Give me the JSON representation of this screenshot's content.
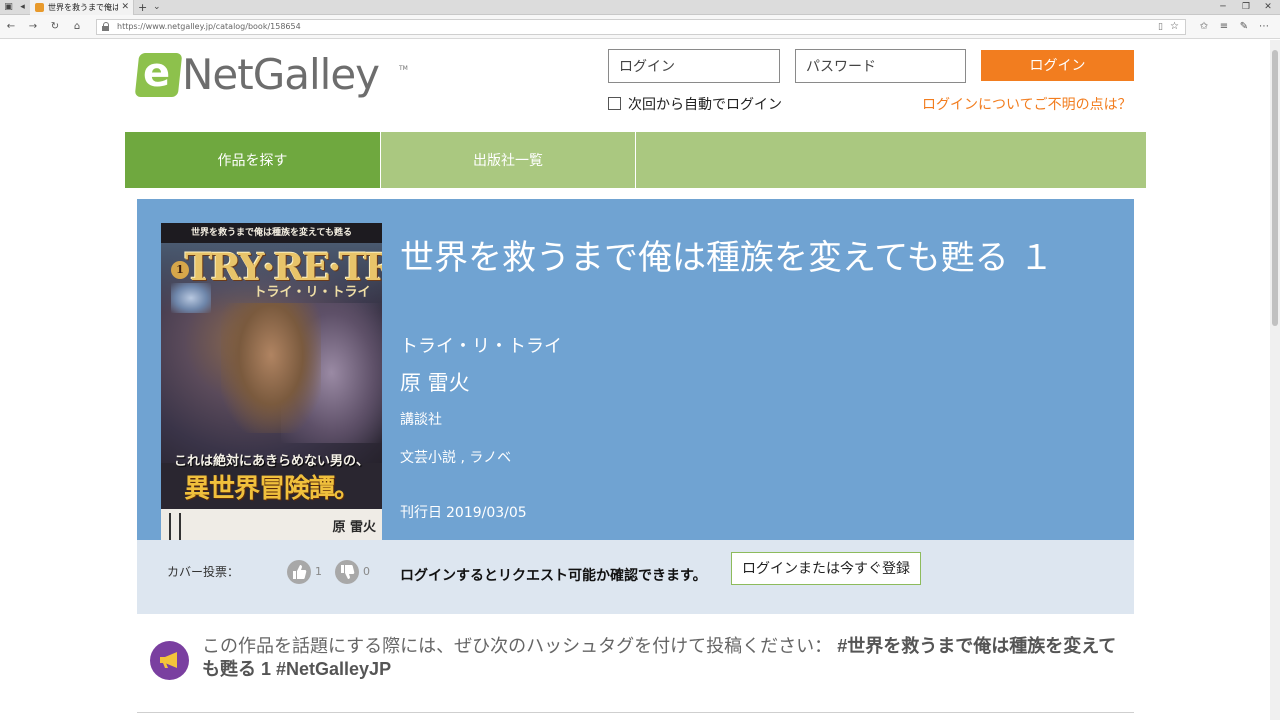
{
  "browser": {
    "tab_title": "世界を救うまで俺は種族を変え",
    "tab_close": "✕",
    "new_tab": "+",
    "url": "https://www.netgalley.jp/catalog/book/158654"
  },
  "header": {
    "logo_text": "NetGalley",
    "logo_tm": "TM",
    "username_placeholder": "ログイン",
    "password_placeholder": "パスワード",
    "login_button": "ログイン",
    "remember_label": "次回から自動でログイン",
    "help_link": "ログインについてご不明の点は？"
  },
  "nav": {
    "items": [
      {
        "label": "作品を探す",
        "active": true
      },
      {
        "label": "出版社一覧",
        "active": false
      }
    ]
  },
  "book": {
    "title": "世界を救うまで俺は種族を変えても甦る １",
    "subtitle": "トライ・リ・トライ",
    "author": "原 雷火",
    "publisher": "講談社",
    "genres": "文芸小説 , ラノベ",
    "date_label": "刊行日",
    "date_value": "2019/03/05",
    "cover": {
      "top_text": "世界を救うまで俺は種族を変えても甦る",
      "volume": "1",
      "logo_title": "TRY·RE·TRY",
      "kana_title": "トライ・リ・トライ",
      "tagline": "これは絶対にあきらめない男の、",
      "big_title": "異世界冒険譚。",
      "author": "原 雷火"
    }
  },
  "votes": {
    "label": "カバー投票：",
    "up_count": "1",
    "down_count": "0",
    "request_text": "ログインするとリクエスト可能か確認できます。",
    "register_button": "ログインまたは今すぐ登録"
  },
  "hashtag": {
    "prefix": "この作品を話題にする際には、ぜひ次のハッシュタグを付けて投稿ください：",
    "tags": "#世界を救うまで俺は種族を変えても甦る 1 #NetGalleyJP"
  },
  "colors": {
    "brand_green": "#8dc14c",
    "nav_active": "#6fa83f",
    "nav_bg": "#aac880",
    "book_panel": "#70a3d2",
    "login_orange": "#f27d1f",
    "hashtag_purple": "#7a3fa0"
  }
}
